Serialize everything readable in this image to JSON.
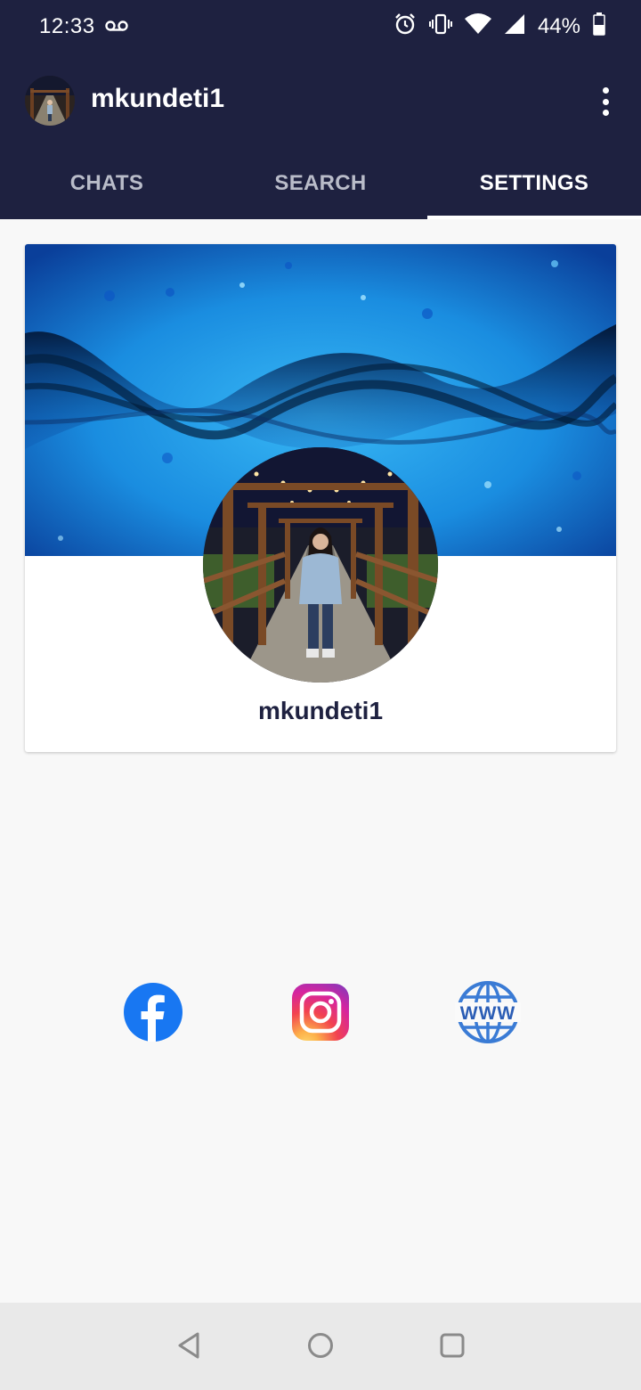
{
  "status_bar": {
    "time": "12:33",
    "battery": "44%",
    "icons": [
      "voicemail-icon",
      "alarm-icon",
      "vibrate-icon",
      "wifi-icon",
      "signal-icon",
      "battery-icon"
    ]
  },
  "header": {
    "title": "mkundeti1",
    "menu_icon": "more-vert-icon"
  },
  "tabs": [
    {
      "label": "CHATS",
      "active": false
    },
    {
      "label": "SEARCH",
      "active": false
    },
    {
      "label": "SETTINGS",
      "active": true
    }
  ],
  "profile": {
    "username": "mkundeti1"
  },
  "social_links": [
    "facebook-icon",
    "instagram-icon",
    "website-icon"
  ],
  "colors": {
    "app_bar": "#1e2140",
    "tab_inactive": "#b9bcc9",
    "facebook": "#1877f2",
    "web": "#3a7bd5"
  },
  "nav_bar": [
    "back-icon",
    "home-icon",
    "recents-icon"
  ]
}
